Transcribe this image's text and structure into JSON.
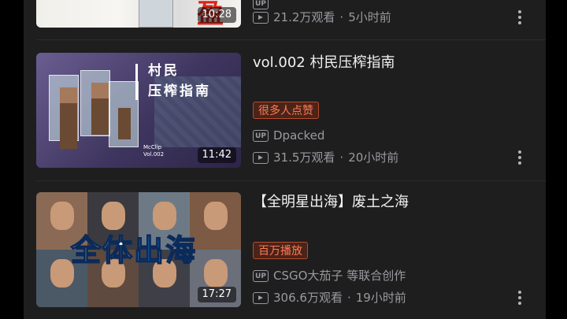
{
  "videos": [
    {
      "title": "",
      "tag": "",
      "uploader": "",
      "views": "21.2万观看",
      "time_ago": "5小时前",
      "duration": "10:28",
      "thumbnail_text": [
        "",
        "盈"
      ]
    },
    {
      "title": "vol.002 村民压榨指南",
      "tag": "很多人点赞",
      "uploader": "Dpacked",
      "views": "31.5万观看",
      "time_ago": "20小时前",
      "duration": "11:42",
      "thumbnail_text": [
        "村民",
        "压榨指南"
      ],
      "thumbnail_logo": [
        "McClip",
        "Vol.002"
      ]
    },
    {
      "title": "【全明星出海】废土之海",
      "tag": "百万播放",
      "uploader": "CSGO大茄子 等联合创作",
      "views": "306.6万观看",
      "time_ago": "19小时前",
      "duration": "17:27",
      "thumbnail_text": [
        "全体",
        "出海"
      ]
    }
  ],
  "labels": {
    "up_badge": "UP",
    "separator": "·"
  },
  "icons": {
    "uploader": "up-badge-icon",
    "views": "play-count-icon",
    "more": "more-vertical-icon"
  },
  "colors": {
    "background": "#1e1e1f",
    "tag_text": "#ff7a55",
    "meta_text": "#9a9a9f"
  }
}
